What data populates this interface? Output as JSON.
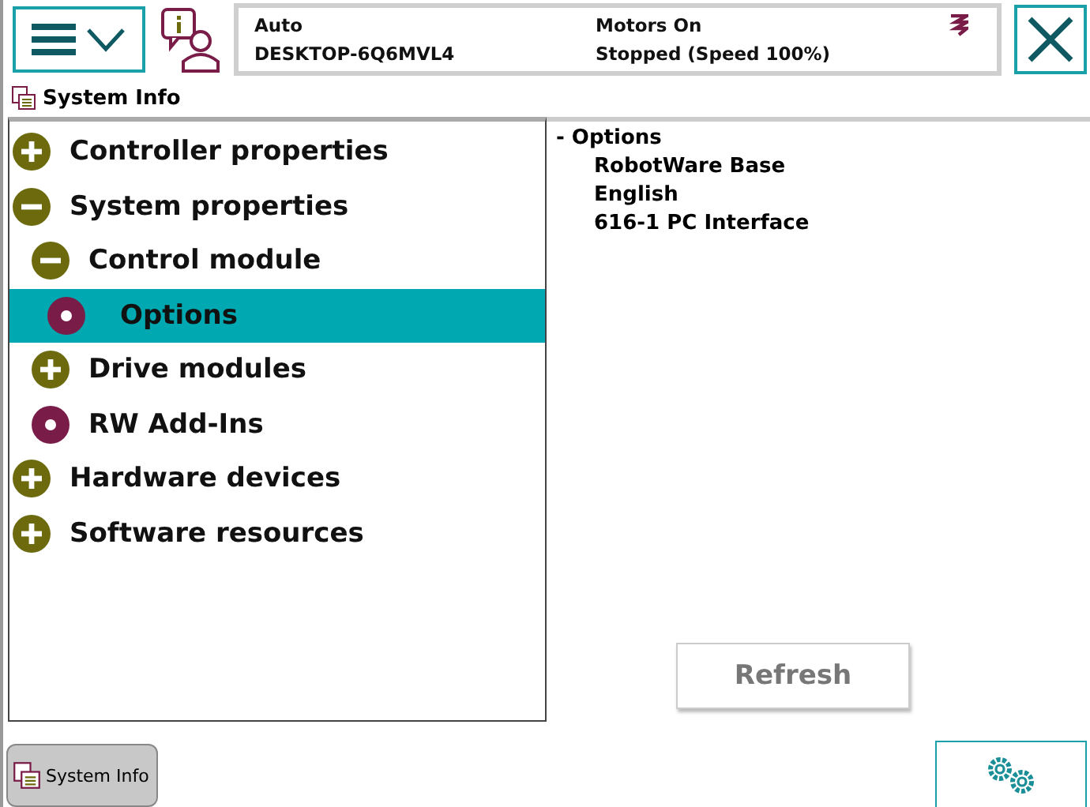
{
  "status": {
    "mode": "Auto",
    "system": "DESKTOP-6Q6MVL4",
    "motors": "Motors On",
    "state": "Stopped (Speed 100%)"
  },
  "title": "System Info",
  "tree": [
    {
      "label": "Controller properties",
      "kind": "node",
      "expanded": false,
      "selected": false
    },
    {
      "label": "System properties",
      "kind": "node",
      "expanded": true,
      "selected": false,
      "children": [
        {
          "label": "Control module",
          "kind": "node",
          "expanded": true,
          "selected": false,
          "children": [
            {
              "label": "Options",
              "kind": "leaf",
              "selected": true
            }
          ]
        },
        {
          "label": "Drive modules",
          "kind": "node",
          "expanded": false,
          "selected": false
        },
        {
          "label": "RW Add-Ins",
          "kind": "leaf",
          "selected": false
        }
      ]
    },
    {
      "label": "Hardware devices",
      "kind": "node",
      "expanded": false,
      "selected": false
    },
    {
      "label": "Software resources",
      "kind": "node",
      "expanded": false,
      "selected": false
    }
  ],
  "details": {
    "heading": "- Options",
    "items": [
      "RobotWare Base",
      "English",
      "616-1 PC Interface"
    ]
  },
  "refresh_button": "Refresh",
  "taskbar": [
    {
      "label": "System Info",
      "selected": true
    }
  ]
}
